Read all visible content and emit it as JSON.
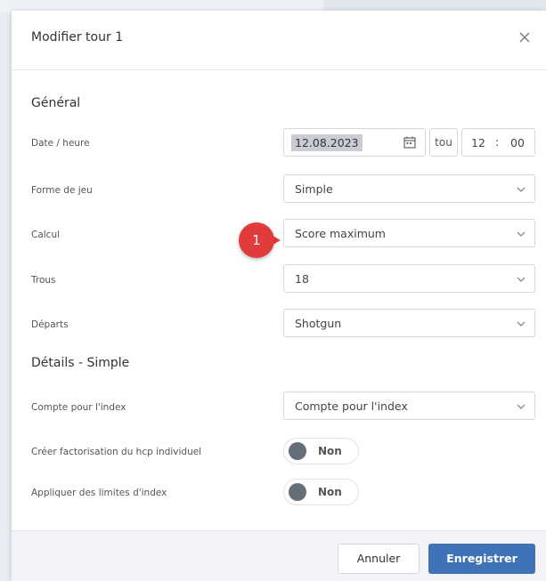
{
  "dialog": {
    "title": "Modifier tour 1",
    "close_icon": "close-icon"
  },
  "general": {
    "section_title": "Général",
    "date_time": {
      "label": "Date / heure",
      "date_value": "12.08.2023",
      "separator": "tou",
      "hour": "12",
      "colon": ":",
      "minute": "00",
      "calendar_icon": "calendar-icon"
    },
    "game_form": {
      "label": "Forme de jeu",
      "value": "Simple"
    },
    "calculation": {
      "label": "Calcul",
      "value": "Score maximum"
    },
    "holes": {
      "label": "Trous",
      "value": "18"
    },
    "starts": {
      "label": "Départs",
      "value": "Shotgun"
    }
  },
  "details": {
    "section_title": "Détails - Simple",
    "counts_for_index": {
      "label": "Compte pour l'index",
      "value": "Compte pour l'index"
    },
    "individual_hcp_factor": {
      "label": "Créer factorisation du hcp individuel",
      "toggle_label": "Non"
    },
    "index_limits": {
      "label": "Appliquer des limites d'index",
      "toggle_label": "Non"
    }
  },
  "annotation": {
    "callout_number": "1"
  },
  "footer": {
    "cancel_label": "Annuler",
    "save_label": "Enregistrer"
  },
  "colors": {
    "primary": "#3f73b6",
    "callout": "#e23b3b",
    "toggle_knob": "#666e7a"
  }
}
